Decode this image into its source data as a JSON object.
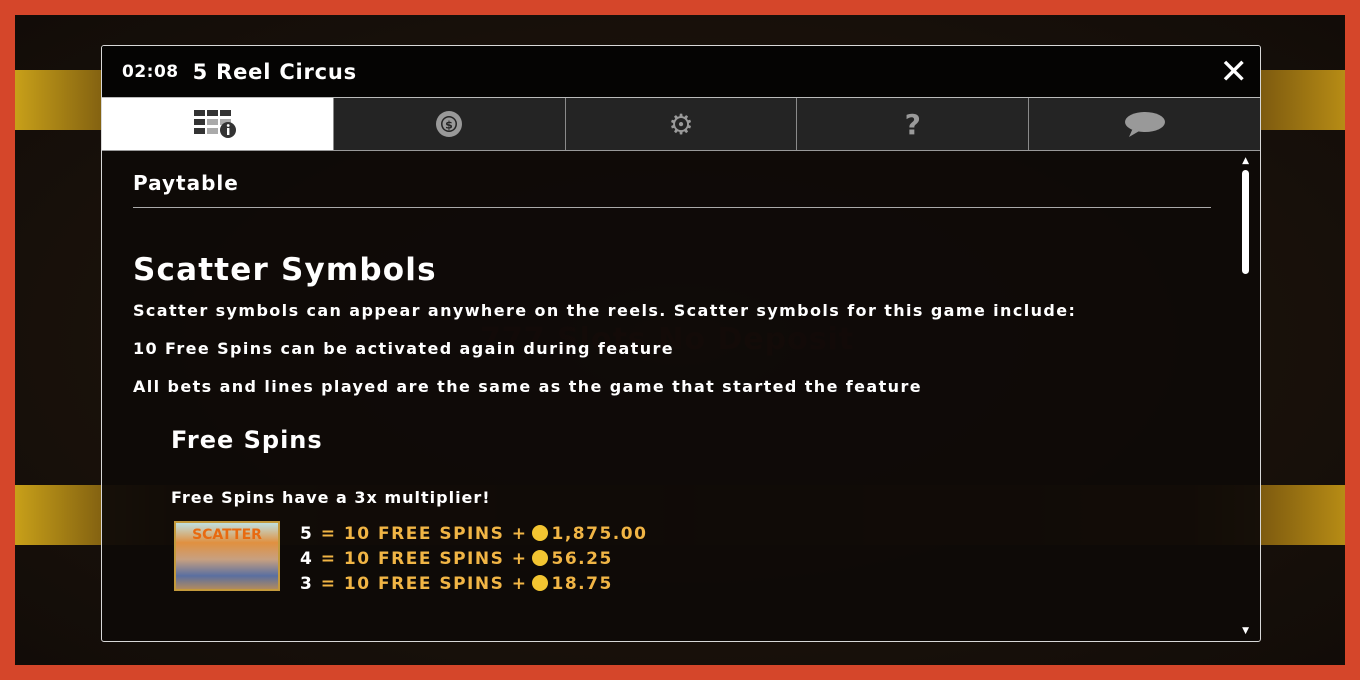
{
  "header": {
    "clock": "02:08",
    "title": "5 Reel Circus",
    "close_icon": "close-icon"
  },
  "tabs": [
    {
      "icon": "paytable-icon",
      "active": true
    },
    {
      "icon": "chip-icon"
    },
    {
      "icon": "gear-icon"
    },
    {
      "icon": "help-icon"
    },
    {
      "icon": "chat-icon"
    }
  ],
  "content": {
    "section_title": "Paytable",
    "heading": "Scatter Symbols",
    "lines": [
      "Scatter symbols can appear anywhere on the reels. Scatter symbols for this game include:",
      "10 Free Spins can be activated again during feature",
      "All bets and lines played are the same as the game that started the feature"
    ],
    "subheading": "Free Spins",
    "note": "Free Spins have a 3x multiplier!",
    "symbol_label": "SCATTER",
    "payouts": [
      {
        "count": "5",
        "text": "= 10 FREE SPINS +",
        "value": "1,875.00"
      },
      {
        "count": "4",
        "text": "= 10 FREE SPINS +",
        "value": "56.25"
      },
      {
        "count": "3",
        "text": "= 10 FREE SPINS +",
        "value": "18.75"
      }
    ]
  },
  "watermark": "Slots No Deposit",
  "colors": {
    "frame": "#d5462a",
    "payout": "#f1b545",
    "coin": "#f3c531"
  }
}
